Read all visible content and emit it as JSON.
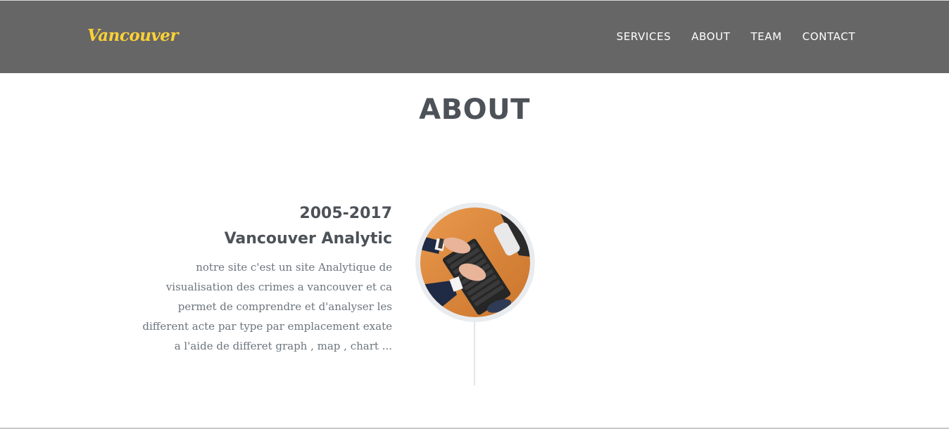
{
  "navbar": {
    "brand": "Vancouver",
    "items": [
      {
        "label": "SERVICES"
      },
      {
        "label": "ABOUT"
      },
      {
        "label": "TEAM"
      },
      {
        "label": "CONTACT"
      }
    ]
  },
  "about": {
    "title": "ABOUT",
    "timeline": [
      {
        "year": "2005-2017",
        "heading": "Vancouver Analytic",
        "description": "notre site c'est un site Analytique de visualisation des crimes a vancouver et ca permet de comprendre et d'analyser les different acte par type par emplacement exate a l'aide de differet graph , map , chart ...",
        "image": "keyboard-typing-photo"
      }
    ]
  },
  "colors": {
    "navbar_bg": "#666666",
    "brand": "#fed136",
    "heading": "#4c5258",
    "muted_text": "#6c757d"
  }
}
